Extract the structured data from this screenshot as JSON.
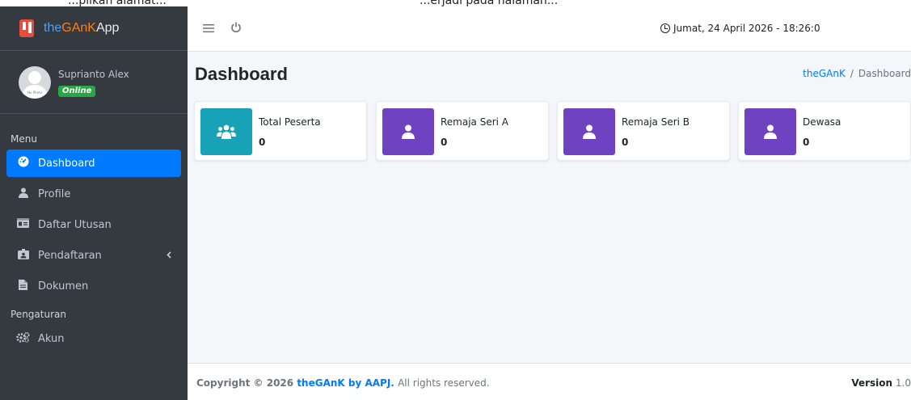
{
  "browser_strip": {
    "text_left": "...pilkan alamat...",
    "text_right": "...erjadi pada halaman..."
  },
  "brand": {
    "part1": "the",
    "part2": "GAnK",
    "part3": "App"
  },
  "user": {
    "name": "Suprianto Alex",
    "status": "Online",
    "avatar_mark": "No Photo"
  },
  "sidebar": {
    "sections": [
      {
        "header": "Menu"
      },
      {
        "header": "Pengaturan"
      }
    ],
    "items": [
      {
        "label": "Dashboard",
        "icon": "tachometer-icon"
      },
      {
        "label": "Profile",
        "icon": "user-icon"
      },
      {
        "label": "Daftar Utusan",
        "icon": "id-card-icon"
      },
      {
        "label": "Pendaftaran",
        "icon": "id-badge-icon"
      },
      {
        "label": "Dokumen",
        "icon": "file-icon"
      },
      {
        "label": "Akun",
        "icon": "cogs-icon"
      }
    ]
  },
  "topbar": {
    "datetime": "Jumat, 24 April 2026 - 18:26:0"
  },
  "header": {
    "title": "Dashboard",
    "breadcrumb_link": "theGAnK",
    "breadcrumb_current": "Dashboard"
  },
  "cards": [
    {
      "label": "Total Peserta",
      "value": "0",
      "color": "#17a2b8",
      "icon": "users-icon"
    },
    {
      "label": "Remaja Seri A",
      "value": "0",
      "color": "#6f42c1",
      "icon": "user-icon"
    },
    {
      "label": "Remaja Seri B",
      "value": "0",
      "color": "#6f42c1",
      "icon": "user-icon"
    },
    {
      "label": "Dewasa",
      "value": "0",
      "color": "#6f42c1",
      "icon": "user-icon"
    }
  ],
  "footer": {
    "copyright_prefix": "Copyright © 2026",
    "brand_link": "theGAnK by AAPJ.",
    "suffix": "All rights reserved.",
    "version_label": "Version",
    "version_value": "1.0"
  },
  "colors": {
    "sidebar_bg": "#343a40",
    "active": "#007bff",
    "teal": "#17a2b8",
    "purple": "#6f42c1",
    "online": "#28a745"
  }
}
